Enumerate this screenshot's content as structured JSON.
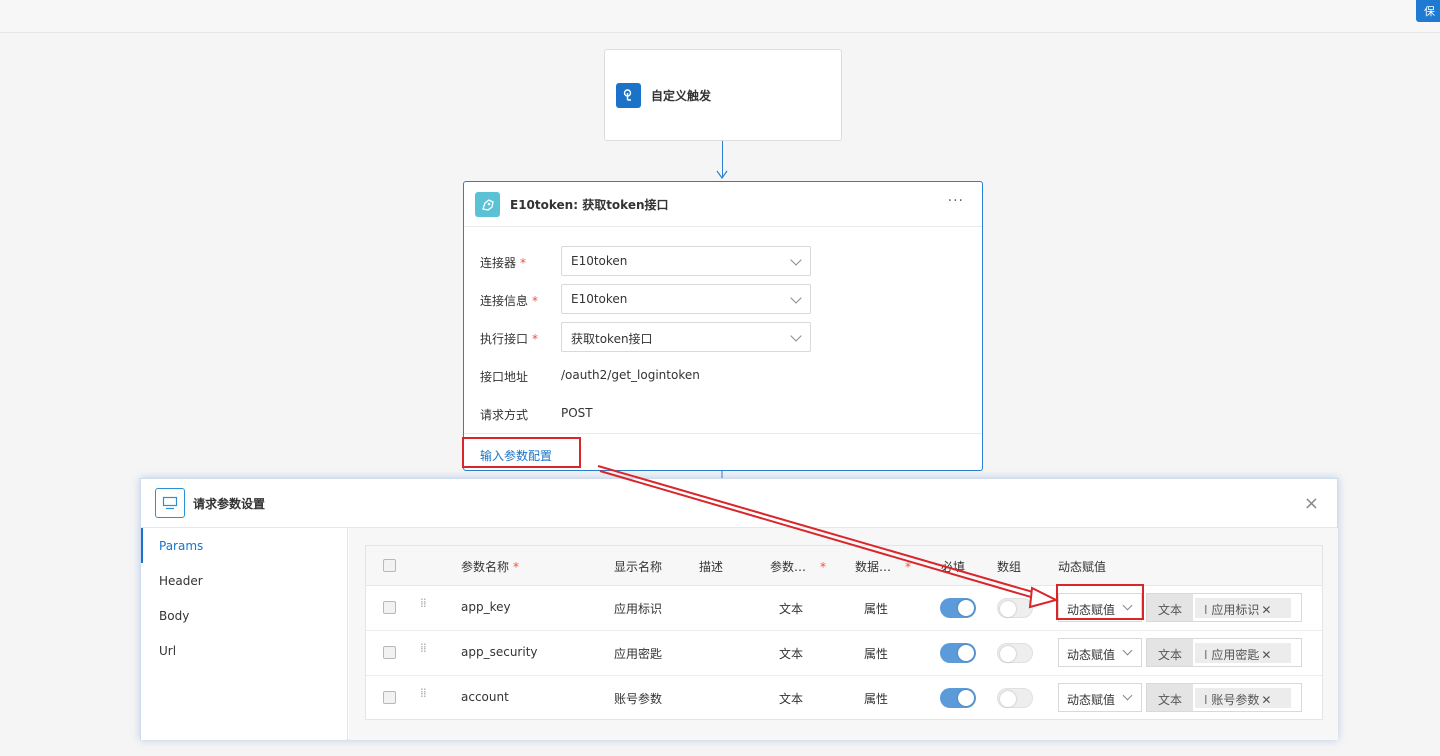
{
  "topbar": {
    "button_label": "保"
  },
  "trigger": {
    "title": "自定义触发",
    "icon": "trigger-icon"
  },
  "connector_node": {
    "title": "E10token: 获取token接口",
    "more_label": "···",
    "fields": [
      {
        "label": "连接器",
        "required": true,
        "value": "E10token"
      },
      {
        "label": "连接信息",
        "required": true,
        "value": "E10token"
      },
      {
        "label": "执行接口",
        "required": true,
        "value": "获取token接口"
      }
    ],
    "info": [
      {
        "label": "接口地址",
        "value": "/oauth2/get_logintoken"
      },
      {
        "label": "请求方式",
        "value": "POST"
      }
    ],
    "footer_link": "输入参数配置"
  },
  "modal": {
    "title": "请求参数设置",
    "close_label": "×",
    "tabs": [
      "Params",
      "Header",
      "Body",
      "Url"
    ],
    "active_tab": "Params",
    "columns": {
      "name": "参数名称",
      "display": "显示名称",
      "desc": "描述",
      "param_type": "参数…",
      "data_type": "数据…",
      "required": "必填",
      "array": "数组",
      "dynamic": "动态赋值"
    },
    "rows": [
      {
        "name": "app_key",
        "display": "应用标识",
        "param_type": "文本",
        "data_type": "属性",
        "required": true,
        "array": false,
        "dynamic": "动态赋值",
        "value_type": "文本",
        "value_tag": "应用标识"
      },
      {
        "name": "app_security",
        "display": "应用密匙",
        "param_type": "文本",
        "data_type": "属性",
        "required": true,
        "array": false,
        "dynamic": "动态赋值",
        "value_type": "文本",
        "value_tag": "应用密匙"
      },
      {
        "name": "account",
        "display": "账号参数",
        "param_type": "文本",
        "data_type": "属性",
        "required": true,
        "array": false,
        "dynamic": "动态赋值",
        "value_type": "文本",
        "value_tag": "账号参数"
      }
    ]
  },
  "colors": {
    "primary": "#1a73c9",
    "annotation": "#d9262a",
    "toggle_on": "#5b9bd9",
    "required_star": "#e8563f"
  }
}
